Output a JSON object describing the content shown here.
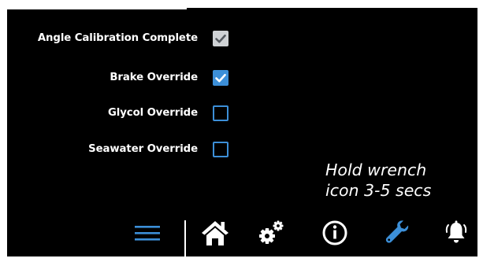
{
  "options": [
    {
      "label": "Angle Calibration Complete",
      "state": "checked-disabled"
    },
    {
      "label": "Brake Override",
      "state": "checked-active"
    },
    {
      "label": "Glycol Override",
      "state": "unchecked"
    },
    {
      "label": "Seawater Override",
      "state": "unchecked"
    }
  ],
  "hint": {
    "line1": "Hold wrench",
    "line2": "icon 3-5 secs"
  },
  "toolbar": {
    "icons": [
      "menu-icon",
      "home-icon",
      "gears-icon",
      "info-icon",
      "wrench-icon",
      "alarm-bell-icon"
    ],
    "active_icon": "wrench-icon"
  },
  "colors": {
    "background": "#000000",
    "accent": "#3c8fd8",
    "disabled_check": "#cfd2d5",
    "text": "#ffffff"
  }
}
